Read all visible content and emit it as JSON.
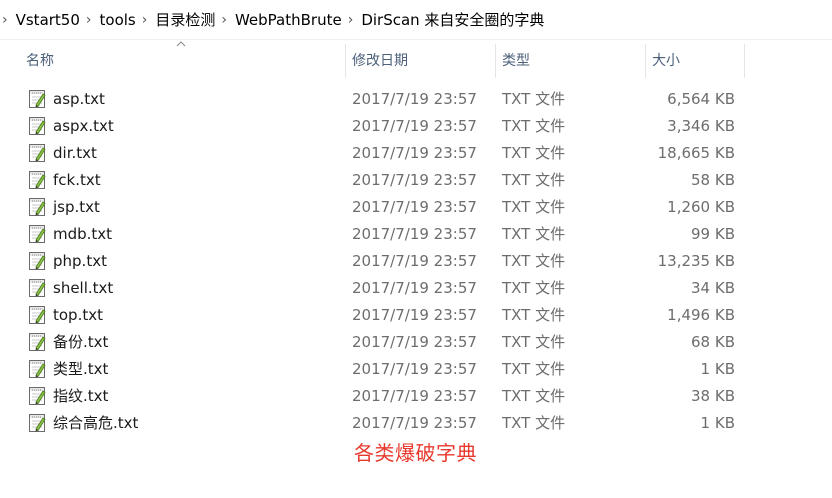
{
  "breadcrumb": [
    "Vstart50",
    "tools",
    "目录检测",
    "WebPathBrute",
    "DirScan 来自安全圈的字典"
  ],
  "columns": {
    "name": "名称",
    "date": "修改日期",
    "type": "类型",
    "size": "大小"
  },
  "sort": {
    "column": "name",
    "direction": "ascending"
  },
  "files": [
    {
      "name": "asp.txt",
      "date": "2017/7/19 23:57",
      "type": "TXT 文件",
      "size": "6,564 KB"
    },
    {
      "name": "aspx.txt",
      "date": "2017/7/19 23:57",
      "type": "TXT 文件",
      "size": "3,346 KB"
    },
    {
      "name": "dir.txt",
      "date": "2017/7/19 23:57",
      "type": "TXT 文件",
      "size": "18,665 KB"
    },
    {
      "name": "fck.txt",
      "date": "2017/7/19 23:57",
      "type": "TXT 文件",
      "size": "58 KB"
    },
    {
      "name": "jsp.txt",
      "date": "2017/7/19 23:57",
      "type": "TXT 文件",
      "size": "1,260 KB"
    },
    {
      "name": "mdb.txt",
      "date": "2017/7/19 23:57",
      "type": "TXT 文件",
      "size": "99 KB"
    },
    {
      "name": "php.txt",
      "date": "2017/7/19 23:57",
      "type": "TXT 文件",
      "size": "13,235 KB"
    },
    {
      "name": "shell.txt",
      "date": "2017/7/19 23:57",
      "type": "TXT 文件",
      "size": "34 KB"
    },
    {
      "name": "top.txt",
      "date": "2017/7/19 23:57",
      "type": "TXT 文件",
      "size": "1,496 KB"
    },
    {
      "name": "备份.txt",
      "date": "2017/7/19 23:57",
      "type": "TXT 文件",
      "size": "68 KB"
    },
    {
      "name": "类型.txt",
      "date": "2017/7/19 23:57",
      "type": "TXT 文件",
      "size": "1 KB"
    },
    {
      "name": "指纹.txt",
      "date": "2017/7/19 23:57",
      "type": "TXT 文件",
      "size": "38 KB"
    },
    {
      "name": "综合高危.txt",
      "date": "2017/7/19 23:57",
      "type": "TXT 文件",
      "size": "1 KB"
    }
  ],
  "annotation": "各类爆破字典",
  "colors": {
    "header_text": "#4c607a",
    "annotation": "#e8392e",
    "meta_text": "#6d6d6d"
  },
  "icons": {
    "file": "notepad-text-file-icon",
    "separator": "chevron-right-icon",
    "sort": "sort-ascending-icon"
  }
}
